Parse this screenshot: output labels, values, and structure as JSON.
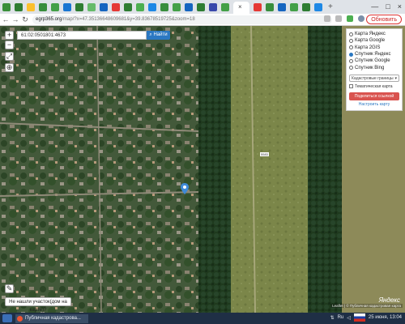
{
  "browser": {
    "tab_close": "×",
    "new_tab": "+",
    "window_controls": {
      "minimize": "—",
      "maximize": "□",
      "close": "×"
    },
    "nav": {
      "back": "←",
      "forward": "→",
      "reload": "↻"
    },
    "url_host": "egrp365.org",
    "url_rest": "/map/?x=47.35136648609681&y=39.83678519725&zoom=18",
    "update_label": "Обновить",
    "more_label": "⋮"
  },
  "search": {
    "value": "61:02:0501801:4673",
    "button_label": "Найти",
    "button_icon": "search-icon"
  },
  "map_controls": {
    "zoom_in": "+",
    "zoom_out": "−",
    "fullscreen": "⤢",
    "layers": "⊕",
    "edit": "✎"
  },
  "layer_panel": {
    "options": [
      {
        "label": "Карта Яндекс",
        "selected": false
      },
      {
        "label": "Карта Google",
        "selected": false
      },
      {
        "label": "Карта 2GIS",
        "selected": false
      },
      {
        "label": "Спутник Яндекс",
        "selected": true
      },
      {
        "label": "Спутник Google",
        "selected": false
      },
      {
        "label": "Спутник Bing",
        "selected": false
      }
    ],
    "select_label": "Кадастровые границы",
    "thematic_label": "Тематическая карта",
    "share_label": "Поделиться ссылкой",
    "setup_label": "Настроить карту"
  },
  "not_found_label": "Не нашли участок(дом на карте)?",
  "map_attrib": "Leaflet | © Публичная кадастровая карта",
  "yandex_logo": "Яндекс",
  "parcel_label": "5583",
  "taskbar": {
    "task_label": "Публичная кадастрова...",
    "lang": "Ru",
    "date": "25 июня, 13:04"
  }
}
